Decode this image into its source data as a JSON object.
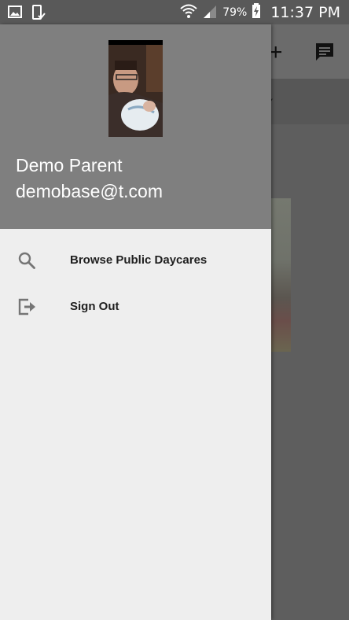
{
  "status_bar": {
    "battery_percent": "79%",
    "time": "11:37 PM",
    "icons": [
      "image-icon",
      "phone-check-icon",
      "wifi-icon",
      "signal-icon",
      "battery-icon"
    ]
  },
  "background_app": {
    "tab_label": "Y",
    "toolbar_icons": [
      "add-icon",
      "chat-icon"
    ]
  },
  "drawer": {
    "header": {
      "name": "Demo Parent",
      "email": "demobase@t.com"
    },
    "menu": [
      {
        "label": "Browse Public Daycares",
        "icon": "search-icon"
      },
      {
        "label": "Sign Out",
        "icon": "sign-out-icon"
      }
    ]
  },
  "colors": {
    "status_bar": "#595959",
    "drawer_header": "#7f7f7f",
    "drawer_body": "#eeeeee",
    "scrim": "#5c5c5c"
  }
}
